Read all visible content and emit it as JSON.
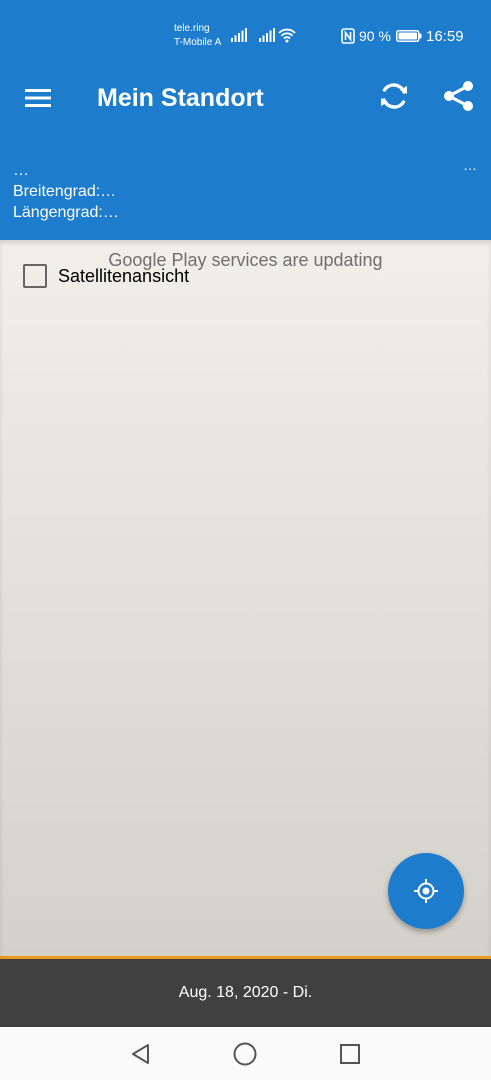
{
  "status_bar": {
    "carrier_1": "tele.ring",
    "carrier_2": "T-Mobile A",
    "battery_percent": "90 %",
    "time": "16:59",
    "icons": [
      "signal-icon",
      "signal-icon",
      "wifi-icon",
      "nfc-icon",
      "battery-icon"
    ]
  },
  "app_bar": {
    "title": "Mein Standort",
    "menu_icon": "menu-icon",
    "refresh_icon": "refresh-icon",
    "share_icon": "share-icon"
  },
  "location": {
    "address": "…",
    "latitude": "Breitengrad:…",
    "longitude": "Längengrad:…",
    "corner_text": "…"
  },
  "map": {
    "message": "Google Play services are updating",
    "satellite_label": "Satellitenansicht",
    "satellite_checked": false,
    "locate_icon": "my-location-icon"
  },
  "footer": {
    "date": "Aug. 18, 2020 - Di."
  },
  "nav": {
    "back_icon": "back-icon",
    "home_icon": "home-icon",
    "recents_icon": "recents-icon"
  },
  "colors": {
    "primary": "#1d7dcc",
    "footer_bg": "#404040",
    "footer_accent": "#e69b1e"
  }
}
